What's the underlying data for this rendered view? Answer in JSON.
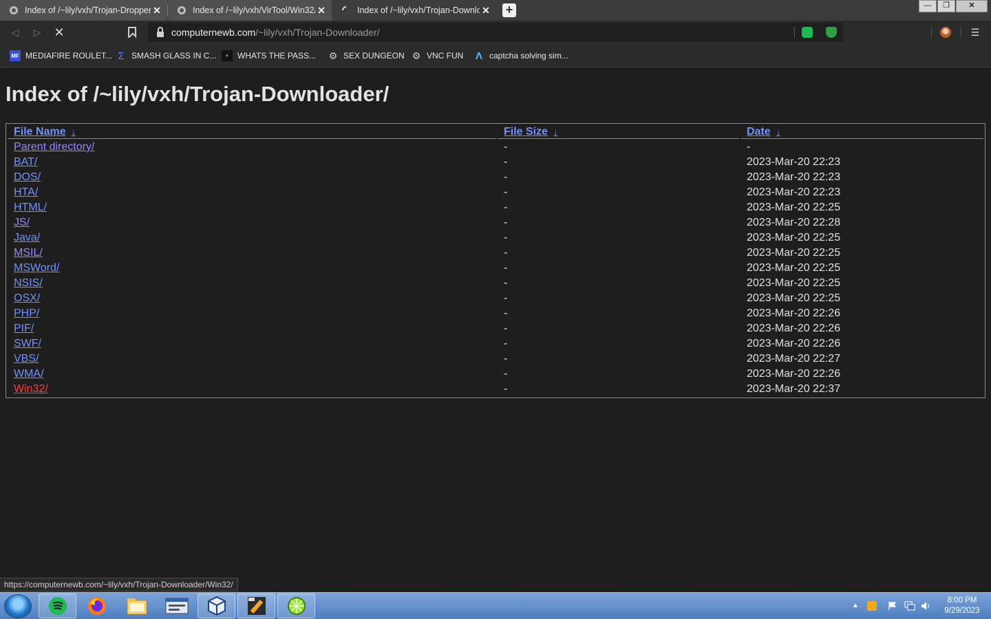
{
  "tabs": [
    {
      "title": "Index of /~lily/vxh/Trojan-Dropper",
      "close": "✕"
    },
    {
      "title": "Index of /~lily/vxh/VirTool/Win32/",
      "close": "✕"
    },
    {
      "title": "Index of /~lily/vxh/Trojan-Downlo",
      "close": "✕"
    }
  ],
  "new_tab": "+",
  "window_controls": {
    "minimize": "—",
    "maximize": "❐",
    "close": "✕"
  },
  "toolbar": {
    "back": "◁",
    "forward": "▷",
    "reload": "✕",
    "url_domain": "computernewb.com",
    "url_path": "/~lily/vxh/Trojan-Downloader/",
    "menu": "☰"
  },
  "bookmarks": [
    {
      "label": "MEDIAFIRE ROULET...",
      "icon": "mediafire-icon",
      "glyph": "MF"
    },
    {
      "label": "SMASH GLASS IN C...",
      "icon": "sigma-icon",
      "glyph": "Σ"
    },
    {
      "label": "WHATS THE PASS...",
      "icon": "dark-square-icon",
      "glyph": "▪"
    },
    {
      "label": "SEX DUNGEON",
      "icon": "dungeon-icon",
      "glyph": "⚙"
    },
    {
      "label": "VNC FUN",
      "icon": "vnc-icon",
      "glyph": "⚙"
    },
    {
      "label": "captcha solving sim...",
      "icon": "lambda-icon",
      "glyph": "Λ"
    }
  ],
  "page": {
    "heading": "Index of /~lily/vxh/Trojan-Downloader/",
    "columns": {
      "name": "File Name",
      "size": "File Size",
      "date": "Date",
      "sort_arrow": "↓"
    },
    "rows": [
      {
        "name": "Parent directory/",
        "size": "-",
        "date": "-"
      },
      {
        "name": "BAT/",
        "size": "-",
        "date": "2023-Mar-20 22:23"
      },
      {
        "name": "DOS/",
        "size": "-",
        "date": "2023-Mar-20 22:23"
      },
      {
        "name": "HTA/",
        "size": "-",
        "date": "2023-Mar-20 22:23"
      },
      {
        "name": "HTML/",
        "size": "-",
        "date": "2023-Mar-20 22:25"
      },
      {
        "name": "JS/",
        "size": "-",
        "date": "2023-Mar-20 22:28"
      },
      {
        "name": "Java/",
        "size": "-",
        "date": "2023-Mar-20 22:25"
      },
      {
        "name": "MSIL/",
        "size": "-",
        "date": "2023-Mar-20 22:25"
      },
      {
        "name": "MSWord/",
        "size": "-",
        "date": "2023-Mar-20 22:25"
      },
      {
        "name": "NSIS/",
        "size": "-",
        "date": "2023-Mar-20 22:25"
      },
      {
        "name": "OSX/",
        "size": "-",
        "date": "2023-Mar-20 22:25"
      },
      {
        "name": "PHP/",
        "size": "-",
        "date": "2023-Mar-20 22:26"
      },
      {
        "name": "PIF/",
        "size": "-",
        "date": "2023-Mar-20 22:26"
      },
      {
        "name": "SWF/",
        "size": "-",
        "date": "2023-Mar-20 22:26"
      },
      {
        "name": "VBS/",
        "size": "-",
        "date": "2023-Mar-20 22:27"
      },
      {
        "name": "WMA/",
        "size": "-",
        "date": "2023-Mar-20 22:26"
      },
      {
        "name": "Win32/",
        "size": "-",
        "date": "2023-Mar-20 22:37"
      }
    ]
  },
  "status_url": "https://computernewb.com/~lily/vxh/Trojan-Downloader/Win32/",
  "taskbar": {
    "apps": [
      "spotify-icon",
      "firefox-icon",
      "file-explorer-icon",
      "window-app-icon",
      "virtualbox-icon",
      "vm-tool-icon",
      "lime-app-icon"
    ],
    "clock_time": "8:00 PM",
    "clock_date": "9/29/2023"
  },
  "colors": {
    "link": "#7391ff",
    "link_visited": "#9a86ff",
    "link_hover": "#ff3b3b",
    "page_bg": "#1e1e1e"
  }
}
